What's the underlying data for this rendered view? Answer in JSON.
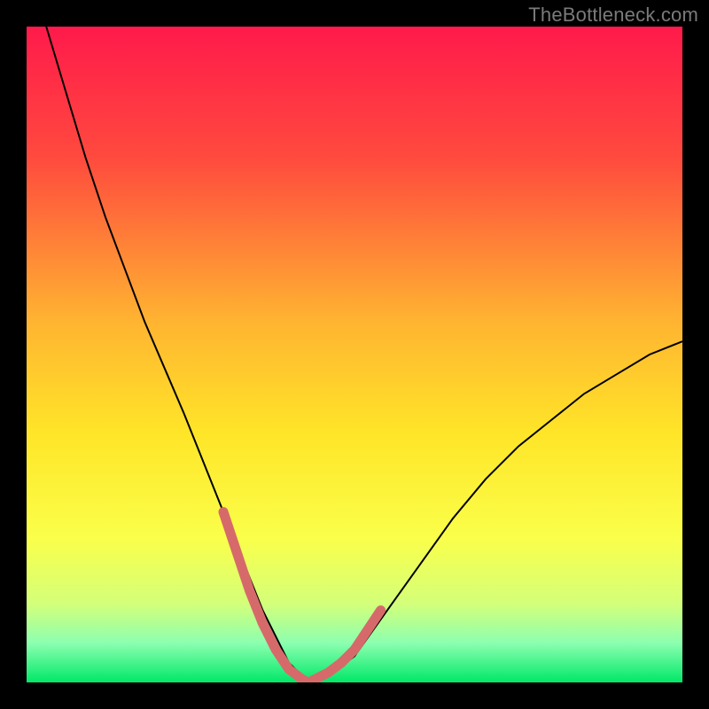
{
  "watermark": {
    "text": "TheBottleneck.com"
  },
  "chart_data": {
    "type": "line",
    "title": "",
    "xlabel": "",
    "ylabel": "",
    "xlim": [
      0,
      100
    ],
    "ylim": [
      0,
      100
    ],
    "grid": false,
    "legend": false,
    "background_gradient": {
      "stops": [
        {
          "offset": 0.0,
          "color": "#ff1a4b"
        },
        {
          "offset": 0.2,
          "color": "#ff4a3e"
        },
        {
          "offset": 0.45,
          "color": "#ffb431"
        },
        {
          "offset": 0.62,
          "color": "#ffe528"
        },
        {
          "offset": 0.78,
          "color": "#faff4a"
        },
        {
          "offset": 0.88,
          "color": "#d4ff7a"
        },
        {
          "offset": 0.94,
          "color": "#8cffb0"
        },
        {
          "offset": 1.0,
          "color": "#00e868"
        }
      ]
    },
    "series": [
      {
        "name": "bottleneck-curve",
        "type": "line",
        "color": "#000000",
        "width": 2,
        "x": [
          3,
          6,
          9,
          12,
          15,
          18,
          21,
          24,
          26,
          28,
          30,
          32,
          34,
          36,
          38,
          40,
          42,
          44,
          46,
          50,
          55,
          60,
          65,
          70,
          75,
          80,
          85,
          90,
          95,
          100
        ],
        "y": [
          100,
          90,
          80,
          71,
          63,
          55,
          48,
          41,
          36,
          31,
          26,
          21,
          16,
          11,
          7,
          3,
          1,
          0,
          1,
          4,
          11,
          18,
          25,
          31,
          36,
          40,
          44,
          47,
          50,
          52
        ]
      },
      {
        "name": "optimal-zone-highlight",
        "type": "line",
        "color": "#d66a6a",
        "width": 11,
        "linecap": "round",
        "segments": [
          {
            "x": [
              30,
              32,
              34,
              36,
              38
            ],
            "y": [
              26,
              20,
              14,
              9,
              5
            ]
          },
          {
            "x": [
              38,
              40,
              42,
              43,
              44,
              46,
              48
            ],
            "y": [
              5,
              2,
              0.5,
              0,
              0.5,
              1.5,
              3
            ]
          },
          {
            "x": [
              48,
              50,
              52,
              54
            ],
            "y": [
              3,
              5,
              8,
              11
            ]
          }
        ]
      }
    ]
  }
}
